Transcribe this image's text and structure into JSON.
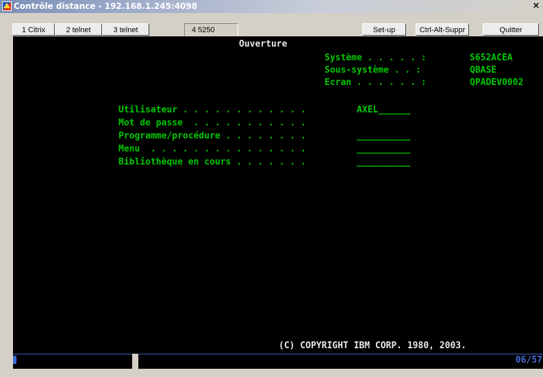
{
  "window": {
    "title": "Contrôle distance - 192.168.1.245:4098",
    "close_label": "×"
  },
  "tabs": [
    {
      "label": "1 Citrix"
    },
    {
      "label": "2 telnet"
    },
    {
      "label": "3 telnet"
    },
    {
      "label": "4 5250",
      "active": true
    }
  ],
  "toolbar": {
    "setup_label": "Set-up",
    "ctrl_alt_del_label": "Ctrl-Alt-Suppr",
    "quit_label": "Quitter"
  },
  "screen": {
    "title": "Ouverture",
    "system_info": [
      {
        "label": "Système . . . . . :",
        "value": "S652ACEA"
      },
      {
        "label": "Sous-système . . :",
        "value": "QBASE"
      },
      {
        "label": "Ecran . . . . . . :",
        "value": "QPADEV0002"
      }
    ],
    "fields": [
      {
        "label": "Utilisateur . . . . . . . . . . . .",
        "value": "AXEL______"
      },
      {
        "label": "Mot de passe  . . . . . . . . . . .",
        "value": ""
      },
      {
        "label": "Programme/procédure . . . . . . . .",
        "value": "__________"
      },
      {
        "label": "Menu  . . . . . . . . . . . . . . .",
        "value": "__________"
      },
      {
        "label": "Bibliothèque en cours . . . . . . .",
        "value": "__________"
      }
    ],
    "copyright": "(C) COPYRIGHT IBM CORP. 1980, 2003."
  },
  "status": {
    "cursor_position": "06/57"
  },
  "colors": {
    "terminal_bg": "#000000",
    "terminal_green": "#00c800",
    "terminal_white": "#e8e8e8",
    "status_blue": "#4a6bd8"
  }
}
